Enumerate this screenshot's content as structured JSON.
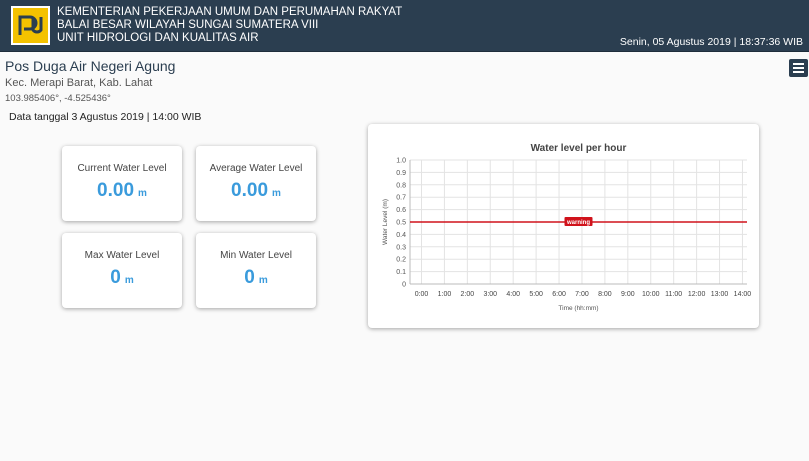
{
  "header": {
    "org_lines": [
      "KEMENTERIAN PEKERJAAN UMUM DAN PERUMAHAN RAKYAT",
      "BALAI BESAR WILAYAH SUNGAI SUMATERA VIII",
      "UNIT HIDROLOGI DAN KUALITAS AIR"
    ],
    "datetime": "Senin, 05 Agustus 2019 | 18:37:36 WIB",
    "logo_icon": "pupr-logo"
  },
  "station": {
    "title": "Pos Duga Air Negeri Agung",
    "location": "Kec. Merapi Barat, Kab. Lahat",
    "coordinates": "103.985406°, -4.525436°",
    "data_date": "Data tanggal 3 Agustus 2019 | 14:00 WIB"
  },
  "menu": {
    "icon": "hamburger-menu-icon"
  },
  "cards": {
    "current": {
      "label": "Current Water Level",
      "value": "0.00",
      "unit": "m"
    },
    "average": {
      "label": "Average Water Level",
      "value": "0.00",
      "unit": "m"
    },
    "max": {
      "label": "Max Water Level",
      "value": "0",
      "unit": "m"
    },
    "min": {
      "label": "Min Water Level",
      "value": "0",
      "unit": "m"
    }
  },
  "colors": {
    "header": "#2b3e50",
    "accent": "#3a9bdc",
    "warning": "#d0121b",
    "logo": "#f4c200"
  },
  "chart_data": {
    "type": "line",
    "title": "Water level per hour",
    "xlabel": "Time (hh:mm)",
    "ylabel": "Water Level (m)",
    "categories": [
      "0:00",
      "1:00",
      "2:00",
      "3:00",
      "4:00",
      "5:00",
      "6:00",
      "7:00",
      "8:00",
      "9:00",
      "10:00",
      "11:00",
      "12:00",
      "13:00",
      "14:00"
    ],
    "y_ticks": [
      "0",
      "0.1",
      "0.2",
      "0.3",
      "0.4",
      "0.5",
      "0.6",
      "0.7",
      "0.8",
      "0.9",
      "1.0"
    ],
    "ylim": [
      0,
      1.0
    ],
    "grid": true,
    "annotations": [
      {
        "label": "warning",
        "y": 0.5,
        "color": "#d0121b"
      }
    ]
  }
}
